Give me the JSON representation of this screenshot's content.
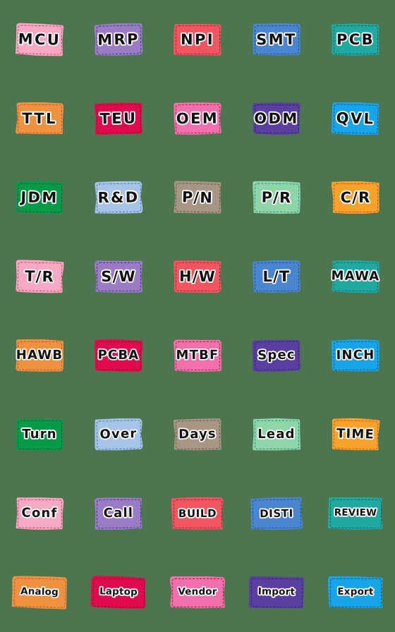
{
  "page": {
    "background_color": "#4d7550",
    "columns": 5,
    "rows": 8,
    "total_stickers": 40
  },
  "stickers": [
    {
      "label": "MCU",
      "fill": "#f6a8c4",
      "stitch": "#e0315f",
      "row": 1,
      "col": 1
    },
    {
      "label": "MRP",
      "fill": "#9a7cc4",
      "stitch": "#4b2f86",
      "row": 1,
      "col": 2
    },
    {
      "label": "NPI",
      "fill": "#ef5660",
      "stitch": "#c8102e",
      "row": 1,
      "col": 3
    },
    {
      "label": "SMT",
      "fill": "#4a86d0",
      "stitch": "#1c4f92",
      "row": 1,
      "col": 4
    },
    {
      "label": "PCB",
      "fill": "#1fa9a0",
      "stitch": "#0f5f70",
      "row": 1,
      "col": 5
    },
    {
      "label": "TTL",
      "fill": "#ef9240",
      "stitch": "#d2472a",
      "row": 2,
      "col": 1
    },
    {
      "label": "TEU",
      "fill": "#e00a4f",
      "stitch": "#8f0a28",
      "row": 2,
      "col": 2
    },
    {
      "label": "OEM",
      "fill": "#ef70ab",
      "stitch": "#c41243",
      "row": 2,
      "col": 3
    },
    {
      "label": "ODM",
      "fill": "#5a3fa0",
      "stitch": "#2b2470",
      "row": 2,
      "col": 4
    },
    {
      "label": "QVL",
      "fill": "#16a5e8",
      "stitch": "#13548c",
      "row": 2,
      "col": 5
    },
    {
      "label": "JDM",
      "fill": "#069b47",
      "stitch": "#0c5a46",
      "row": 3,
      "col": 1
    },
    {
      "label": "R&D",
      "fill": "#a5c4e8",
      "stitch": "#4a70a8",
      "row": 3,
      "col": 2
    },
    {
      "label": "P/N",
      "fill": "#a89684",
      "stitch": "#5c5248",
      "row": 3,
      "col": 3
    },
    {
      "label": "P/R",
      "fill": "#8ed5a8",
      "stitch": "#2a8f8a",
      "row": 3,
      "col": 4
    },
    {
      "label": "C/R",
      "fill": "#f9a229",
      "stitch": "#e8401d",
      "row": 3,
      "col": 5
    },
    {
      "label": "T/R",
      "fill": "#f6a8c4",
      "stitch": "#e0315f",
      "row": 4,
      "col": 1
    },
    {
      "label": "S/W",
      "fill": "#9a7cc4",
      "stitch": "#4b2f86",
      "row": 4,
      "col": 2
    },
    {
      "label": "H/W",
      "fill": "#ef5660",
      "stitch": "#c8102e",
      "row": 4,
      "col": 3
    },
    {
      "label": "L/T",
      "fill": "#4a86d0",
      "stitch": "#1c4f92",
      "row": 4,
      "col": 4
    },
    {
      "label": "MAWA",
      "fill": "#1fa9a0",
      "stitch": "#0f5f70",
      "row": 4,
      "col": 5
    },
    {
      "label": "HAWB",
      "fill": "#ef9240",
      "stitch": "#d2472a",
      "row": 5,
      "col": 1
    },
    {
      "label": "PCBA",
      "fill": "#e00a4f",
      "stitch": "#8f0a28",
      "row": 5,
      "col": 2
    },
    {
      "label": "MTBF",
      "fill": "#ef70ab",
      "stitch": "#c41243",
      "row": 5,
      "col": 3
    },
    {
      "label": "Spec",
      "fill": "#5a3fa0",
      "stitch": "#2b2470",
      "row": 5,
      "col": 4
    },
    {
      "label": "INCH",
      "fill": "#16a5e8",
      "stitch": "#13548c",
      "row": 5,
      "col": 5
    },
    {
      "label": "Turn",
      "fill": "#069b47",
      "stitch": "#0c5a46",
      "row": 6,
      "col": 1
    },
    {
      "label": "Over",
      "fill": "#a5c4e8",
      "stitch": "#4a70a8",
      "row": 6,
      "col": 2
    },
    {
      "label": "Days",
      "fill": "#a89684",
      "stitch": "#5c5248",
      "row": 6,
      "col": 3
    },
    {
      "label": "Lead",
      "fill": "#8ed5a8",
      "stitch": "#2a8f8a",
      "row": 6,
      "col": 4
    },
    {
      "label": "TIME",
      "fill": "#f9a229",
      "stitch": "#e8401d",
      "row": 6,
      "col": 5
    },
    {
      "label": "Conf",
      "fill": "#f6a8c4",
      "stitch": "#e0315f",
      "row": 7,
      "col": 1
    },
    {
      "label": "Call",
      "fill": "#9a7cc4",
      "stitch": "#4b2f86",
      "row": 7,
      "col": 2
    },
    {
      "label": "BUILD",
      "fill": "#ef5660",
      "stitch": "#c8102e",
      "row": 7,
      "col": 3
    },
    {
      "label": "DISTI",
      "fill": "#4a86d0",
      "stitch": "#1c4f92",
      "row": 7,
      "col": 4
    },
    {
      "label": "REVIEW",
      "fill": "#1fa9a0",
      "stitch": "#0f5f70",
      "row": 7,
      "col": 5
    },
    {
      "label": "Analog",
      "fill": "#ef9240",
      "stitch": "#d2472a",
      "row": 8,
      "col": 1
    },
    {
      "label": "Laptop",
      "fill": "#e00a4f",
      "stitch": "#8f0a28",
      "row": 8,
      "col": 2
    },
    {
      "label": "Vendor",
      "fill": "#ef70ab",
      "stitch": "#c41243",
      "row": 8,
      "col": 3
    },
    {
      "label": "Import",
      "fill": "#5a3fa0",
      "stitch": "#2b2470",
      "row": 8,
      "col": 4
    },
    {
      "label": "Export",
      "fill": "#16a5e8",
      "stitch": "#13548c",
      "row": 8,
      "col": 5
    }
  ]
}
